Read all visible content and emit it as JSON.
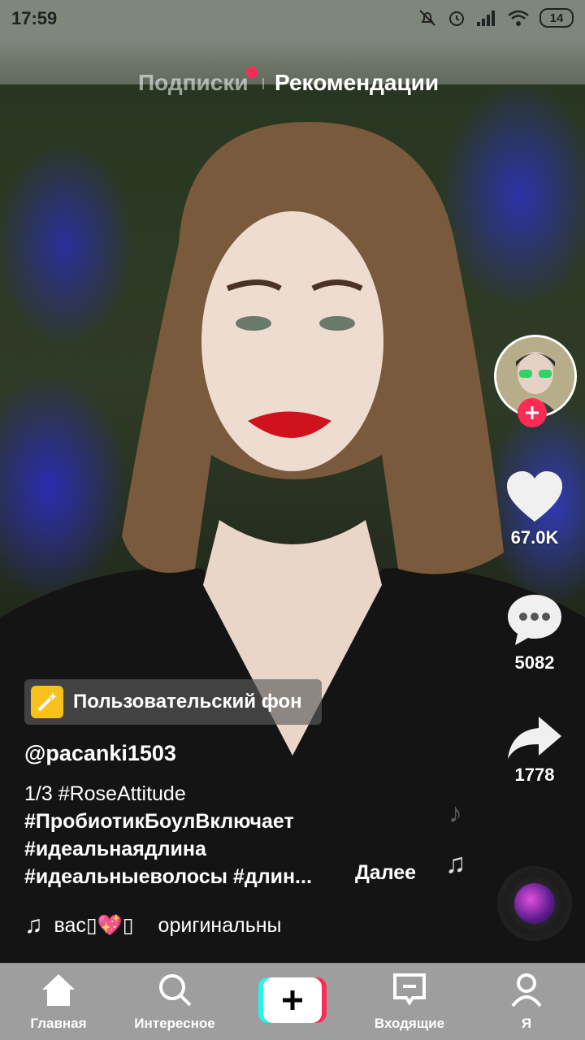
{
  "status_bar": {
    "time": "17:59",
    "battery": "14"
  },
  "top_tabs": {
    "following": "Подписки",
    "recommended": "Рекомендации"
  },
  "right_actions": {
    "likes": "67.0K",
    "comments": "5082",
    "shares": "1778"
  },
  "background_tag": {
    "label": "Пользовательский фон"
  },
  "post": {
    "username": "@pacanki1503",
    "caption_lines": [
      "1/3 #RoseAttitude",
      "#ПробиотикБоулВключает",
      "#идеальнаядлина",
      "#идеальныеволосы #длин..."
    ],
    "more_label": "Далее"
  },
  "music": {
    "title": "вас▯💖▯",
    "subtitle": "оригинальны"
  },
  "bottom_nav": {
    "home": "Главная",
    "discover": "Интересное",
    "inbox": "Входящие",
    "me": "Я"
  },
  "colors": {
    "accent": "#fe2c55",
    "cyan": "#25f4ee",
    "tag_icon": "#f7c21d"
  }
}
